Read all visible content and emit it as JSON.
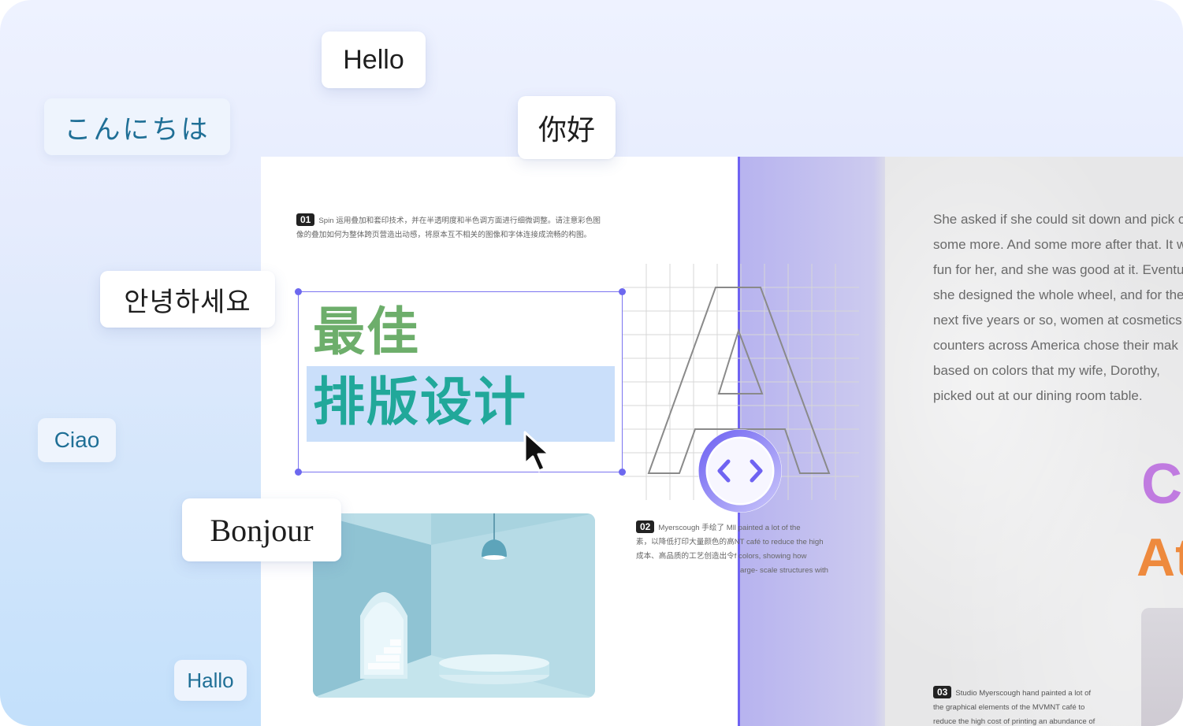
{
  "greetings": {
    "hello": "Hello",
    "japanese": "こんにちは",
    "chinese": "你好",
    "korean": "안녕하세요",
    "italian": "Ciao",
    "french": "Bonjour",
    "german": "Hallo"
  },
  "left_page": {
    "note_01": {
      "number": "01",
      "text": "Spin 运用叠加和套印技术，并在半透明度和半色调方面进行细微调整。请注意彩色图像的叠加如何为整体跨页营造出动感，将原本互不相关的图像和字体连接成流畅的构图。"
    },
    "title_line1": "最佳",
    "title_line2": "排版设计",
    "note_02": {
      "number": "02",
      "text": "Myerscough 手绘了 M",
      "text_cn": "素，以降低打印大量颜色的高",
      "text_cn2": "成本、高品质的工艺创造出令"
    }
  },
  "right_page": {
    "story_lines": [
      "She asked if she could sit down and pick c",
      "some more. And some more after that. It w",
      "fun for her, and she was good at it. Eventu",
      "she designed the whole wheel, and for the",
      "next five years or so, women at cosmetics",
      "counters across America chose their mak",
      "based on colors that my wife, Dorothy,",
      "picked out at our dining room table."
    ],
    "note_02_overflow": {
      "line1": "ll painted a lot of the",
      "line2": "NT café to reduce the high",
      "line3": "f colors, showing how",
      "line4": "arge- scale structures with"
    },
    "big_heading_1": "C",
    "big_heading_2": "At",
    "note_03": {
      "number": "03",
      "line1": "Studio Myerscough hand painted a lot of",
      "line2": "the graphical elements of the MVMNT café to",
      "line3": "reduce the high cost of printing an abundance of"
    }
  },
  "colors": {
    "accent": "#6f63f2",
    "title_green": "#6dae6b",
    "title_teal": "#21a89a",
    "highlight": "#cadffa",
    "heading_purple": "#c07be0",
    "heading_orange": "#ee8a3e"
  },
  "icons": {
    "cursor": "arrow-cursor-icon",
    "compare": "compare-slider-icon"
  }
}
